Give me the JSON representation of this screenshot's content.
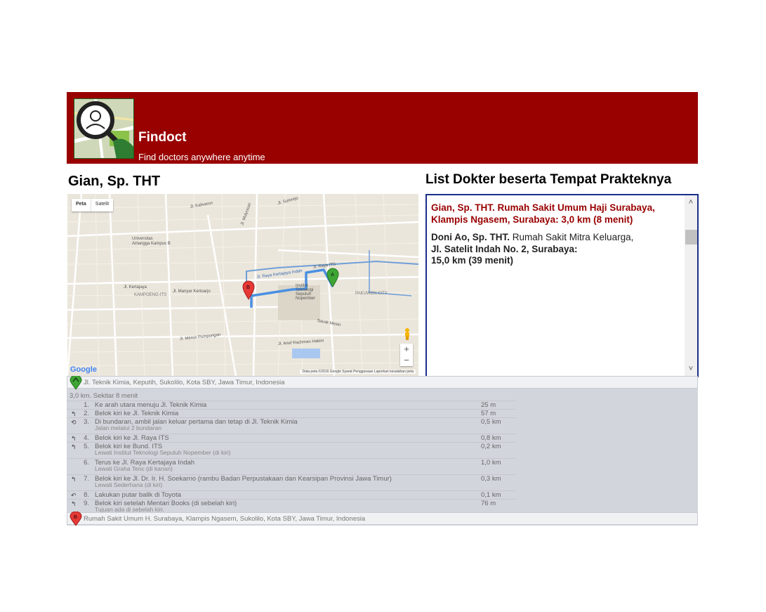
{
  "header": {
    "title": "Findoct",
    "subtitle": "Find doctors anywhere anytime"
  },
  "doctor": {
    "name": "Gian, Sp. THT"
  },
  "list": {
    "title": "List Dokter beserta Tempat Prakteknya",
    "items": [
      {
        "text": "Gian, Sp. THT. Rumah Sakit Umum Haji Surabaya, Klampis Ngasem, Surabaya: 3,0 km (8 menit)"
      },
      {
        "name": "Doni Ao, Sp. THT.",
        "place_line1": "Rumah Sakit Mitra Keluarga,",
        "place_line2": "Jl. Satelit Indah No. 2, Surabaya:",
        "distance": "15,0 km (39 menit)"
      }
    ]
  },
  "map": {
    "type_map": "Peta",
    "type_satellite": "Satelit",
    "google": "Google",
    "attribution": "Data peta ©2016 Google   Syarat Penggunaan   Laporkan kesalahan peta",
    "zoom_in": "+",
    "zoom_out": "−",
    "labels": [
      "Jl. Kalivaron",
      "Jl. Sutorejo",
      "Jl. Mulyosari",
      "Universitas Airlangga Kampus B",
      "Jl. Kertajaya",
      "Jl. Manyar Kertoarjo",
      "KAMPOENG-ITS",
      "Jl. Menur Pumpungan",
      "Jl. Raya ITS",
      "Institut Teknologi Sepuluh Nopember",
      "PAKUWON CITY",
      "Jl. Arief Rachman Hakim",
      "Teknik Mesin",
      "Jl. Kalijudan",
      "Jl. Dr. Ir. H. Soekarno",
      "Jl. Raya Kertajaya Indah"
    ],
    "colors": {
      "route": "#4a90e2",
      "marker_a": "#3fa535",
      "marker_b": "#e53935"
    }
  },
  "directions": {
    "start": "Jl. Teknik Kimia, Keputih, Sukolilo, Kota SBY, Jawa Timur, Indonesia",
    "end": "Rumah Sakit Umum H. Surabaya, Klampis Ngasem, Sukolilo, Kota SBY, Jawa Timur, Indonesia",
    "summary": "3,0 km. Sekitar 8 menit",
    "steps": [
      {
        "num": "1.",
        "text": "Ke arah utara menuju Jl. Teknik Kimia",
        "sub": "",
        "dist": "25 m",
        "icon": ""
      },
      {
        "num": "2.",
        "text": "Belok kiri ke Jl. Teknik Kimia",
        "sub": "",
        "dist": "57 m",
        "icon": "↰"
      },
      {
        "num": "3.",
        "text": "Di bundaran, ambil jalan keluar pertama dan tetap di Jl. Teknik Kimia",
        "sub": "Jalan melalui 2 bundaran",
        "dist": "0,5 km",
        "icon": "⟲"
      },
      {
        "num": "4.",
        "text": "Belok kiri ke Jl. Raya ITS",
        "sub": "",
        "dist": "0,8 km",
        "icon": "↰"
      },
      {
        "num": "5.",
        "text": "Belok kiri ke Bund. ITS",
        "sub": "Lewati Institut Teknologi Sepuluh Nopember (di kiri)",
        "dist": "0,2 km",
        "icon": "↰"
      },
      {
        "num": "6.",
        "text": "Terus ke Jl. Raya Kertajaya Indah",
        "sub": "Lewati Graha Tenc (di kanan)",
        "dist": "1,0 km",
        "icon": ""
      },
      {
        "num": "7.",
        "text": "Belok kiri ke Jl. Dr. Ir. H. Soekarno (rambu Badan Perpustakaan dan Kearsipan Provinsi Jawa Timur)",
        "sub": "Lewati Sederhana (di kiri)",
        "dist": "0,3 km",
        "icon": "↰"
      },
      {
        "num": "8.",
        "text": "Lakukan putar balik di Toyota",
        "sub": "",
        "dist": "0,1 km",
        "icon": "↶"
      },
      {
        "num": "9.",
        "text": "Belok kiri setelah Mentari Books (di sebelah kiri)",
        "sub": "Tujuan ada di sebelah kiri.",
        "dist": "76 m",
        "icon": "↰"
      }
    ]
  }
}
